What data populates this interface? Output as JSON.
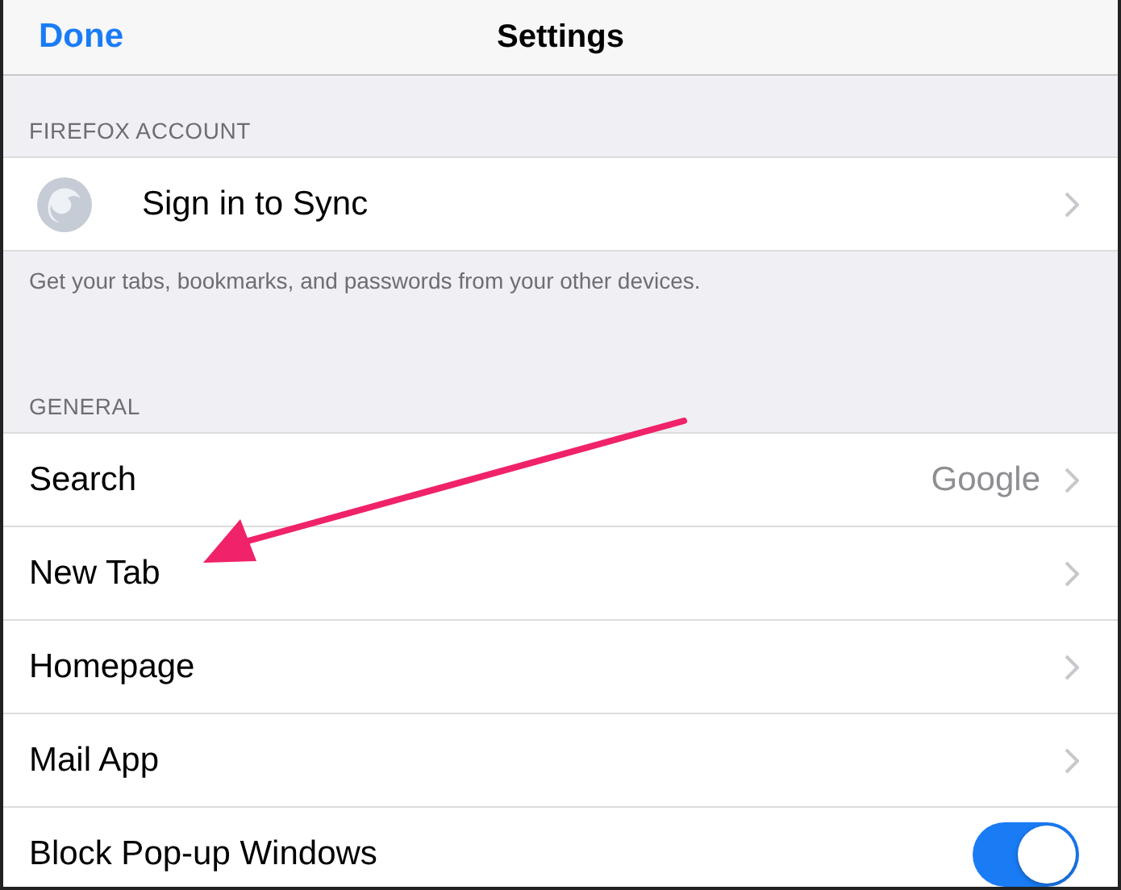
{
  "nav_bar": {
    "left_button": "Done",
    "title": "Settings"
  },
  "sections": [
    {
      "header": "FIREFOX ACCOUNT",
      "footer": "Get your tabs, bookmarks, and passwords from your other devices.",
      "rows": [
        {
          "kind": "account",
          "label": "Sign in to Sync"
        }
      ]
    },
    {
      "header": "GENERAL",
      "rows": [
        {
          "kind": "link",
          "label": "Search",
          "value": "Google"
        },
        {
          "kind": "link",
          "label": "New Tab"
        },
        {
          "kind": "link",
          "label": "Homepage"
        },
        {
          "kind": "link",
          "label": "Mail App"
        },
        {
          "kind": "toggle",
          "label": "Block Pop-up Windows",
          "on": true
        }
      ]
    }
  ]
}
